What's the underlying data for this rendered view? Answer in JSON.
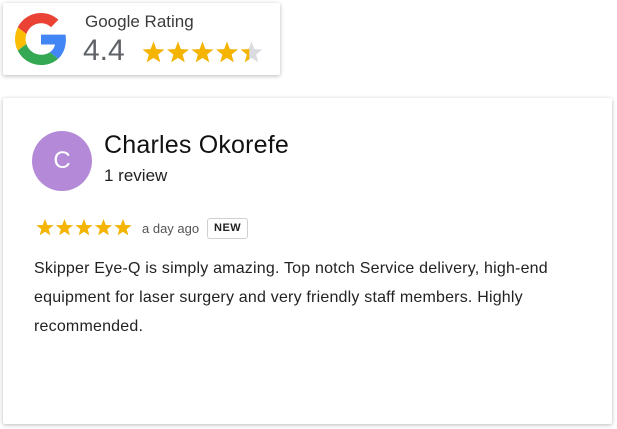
{
  "rating_badge": {
    "title": "Google Rating",
    "score": "4.4",
    "stars_value": 4.4,
    "stars_max": 5
  },
  "review": {
    "avatar_initial": "C",
    "reviewer_name": "Charles Okorefe",
    "review_count": "1 review",
    "stars_value": 5,
    "stars_max": 5,
    "time_ago": "a day ago",
    "badge": "NEW",
    "text": "Skipper Eye-Q is simply amazing. Top notch Service delivery, high-end equipment for laser surgery and very friendly staff members. Highly recommended."
  },
  "colors": {
    "star": "#f5b400",
    "star_empty": "#dadce0",
    "avatar_bg": "#b48ad8"
  },
  "icons": {
    "logo": "google-g-icon",
    "star": "star-icon"
  }
}
